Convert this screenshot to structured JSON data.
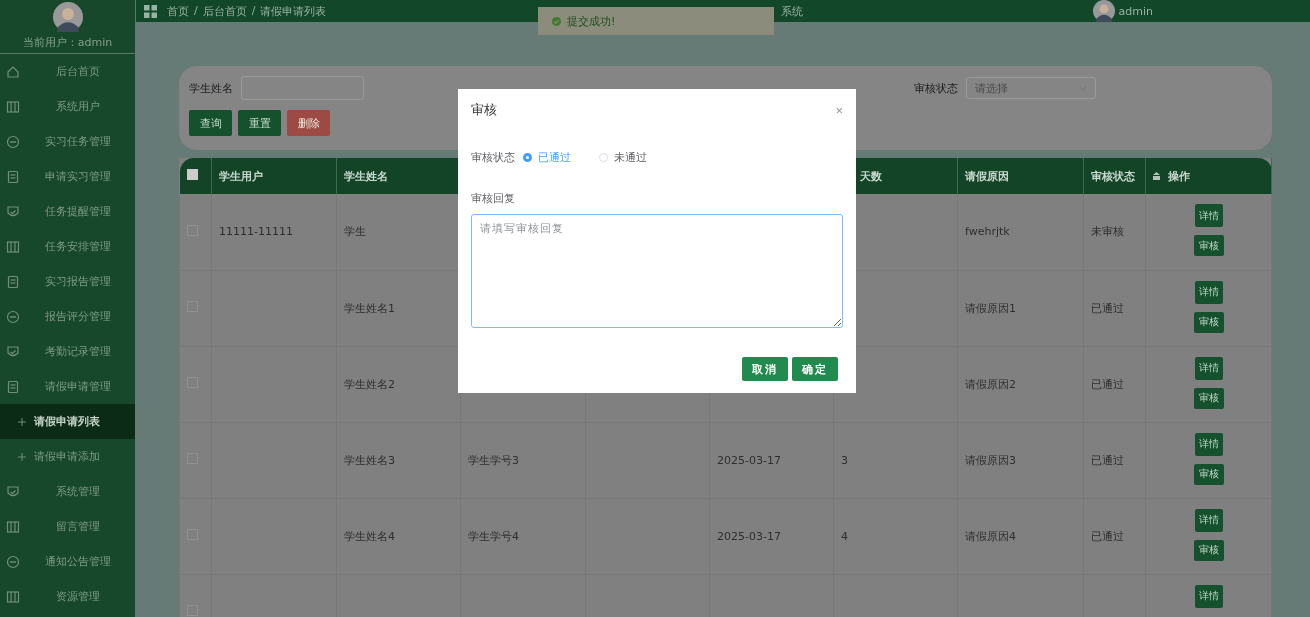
{
  "sidebar": {
    "user_label": "当前用户：admin",
    "items": [
      {
        "label": "后台首页"
      },
      {
        "label": "系统用户"
      },
      {
        "label": "实习任务管理"
      },
      {
        "label": "申请实习管理"
      },
      {
        "label": "任务提醒管理"
      },
      {
        "label": "任务安排管理"
      },
      {
        "label": "实习报告管理"
      },
      {
        "label": "报告评分管理"
      },
      {
        "label": "考勤记录管理"
      },
      {
        "label": "请假申请管理",
        "children": [
          {
            "label": "请假申请列表",
            "selected": true
          },
          {
            "label": "请假申请添加",
            "selected": false
          }
        ]
      },
      {
        "label": "系统管理"
      },
      {
        "label": "留言管理"
      },
      {
        "label": "通知公告管理"
      },
      {
        "label": "资源管理"
      }
    ]
  },
  "topbar": {
    "breadcrumb": [
      "首页",
      "/",
      "后台首页",
      "/",
      "请假申请列表"
    ],
    "title": "系统",
    "user": "admin"
  },
  "toast": {
    "text": "提交成功!"
  },
  "filters": {
    "name_label": "学生姓名",
    "status_label": "审核状态",
    "status_placeholder": "请选择",
    "buttons": [
      {
        "label": "查询",
        "kind": "primary"
      },
      {
        "label": "重置",
        "kind": "primary"
      },
      {
        "label": "删除",
        "kind": "danger"
      }
    ]
  },
  "table": {
    "all_checked": false,
    "columns": [
      "学生用户",
      "学生姓名",
      null,
      null,
      null,
      "天数",
      "请假原因",
      "审核状态",
      "操作"
    ],
    "rows": [
      {
        "checked": false,
        "cells": [
          "11111-11111",
          "学生",
          null,
          null,
          null,
          null,
          "fwehrjtk",
          "未审核"
        ],
        "actions": [
          "详情",
          "审核"
        ]
      },
      {
        "checked": false,
        "cells": [
          null,
          "学生姓名1",
          null,
          null,
          null,
          null,
          "请假原因1",
          "已通过"
        ],
        "actions": [
          "详情",
          "审核"
        ]
      },
      {
        "checked": false,
        "cells": [
          null,
          "学生姓名2",
          null,
          null,
          null,
          null,
          "请假原因2",
          "已通过"
        ],
        "actions": [
          "详情",
          "审核"
        ]
      },
      {
        "checked": false,
        "cells": [
          null,
          "学生姓名3",
          "学生学号3",
          null,
          "2025-03-17",
          "3",
          "请假原因3",
          "已通过"
        ],
        "actions": [
          "详情",
          "审核"
        ]
      },
      {
        "checked": false,
        "cells": [
          null,
          "学生姓名4",
          "学生学号4",
          null,
          "2025-03-17",
          "4",
          "请假原因4",
          "已通过"
        ],
        "actions": [
          "详情",
          "审核"
        ]
      },
      {
        "checked": false,
        "cells": [
          null,
          null,
          null,
          null,
          null,
          null,
          null,
          null
        ],
        "actions": [
          "详情"
        ]
      }
    ]
  },
  "dialog": {
    "title": "审核",
    "close": "×",
    "status_label": "审核状态",
    "options": [
      {
        "label": "已通过",
        "selected": true
      },
      {
        "label": "未通过",
        "selected": false
      }
    ],
    "reply_label": "审核回复",
    "reply_placeholder": "请填写审核回复",
    "buttons": [
      "取消",
      "确定"
    ]
  }
}
